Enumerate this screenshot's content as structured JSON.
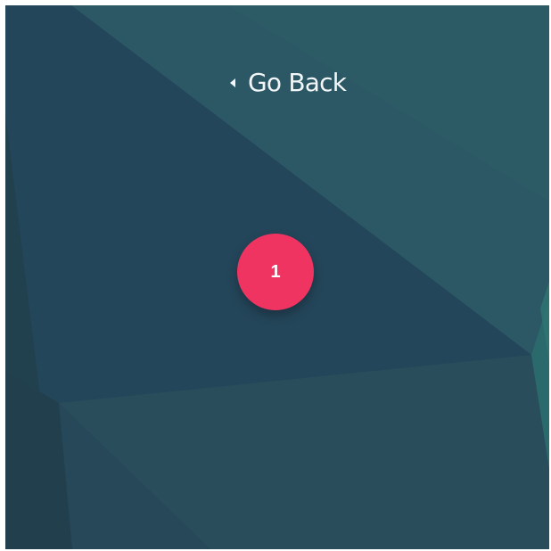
{
  "nav": {
    "go_back_label": "Go Back",
    "icon": "caret-left-icon"
  },
  "badge": {
    "number": "1",
    "color": "#f03462"
  },
  "background": {
    "base_color": "#26495a",
    "accent_color": "#2a6a6f"
  }
}
